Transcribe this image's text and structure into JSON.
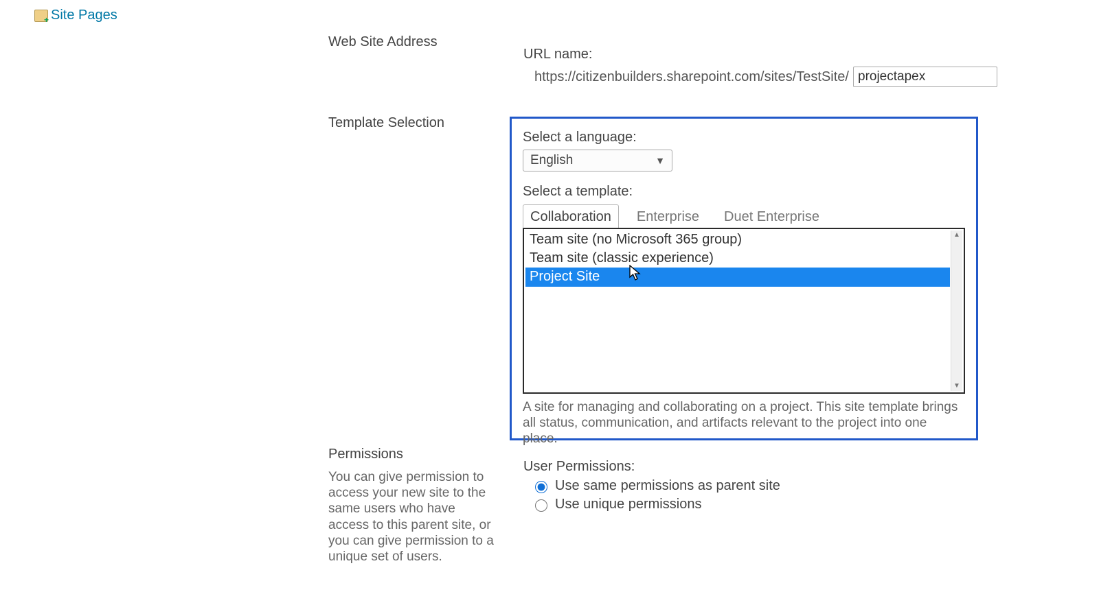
{
  "sidebar": {
    "site_pages": "Site Pages"
  },
  "sections": {
    "web_site_address": "Web Site Address",
    "template_selection": "Template Selection",
    "permissions": "Permissions"
  },
  "permissions_description": "You can give permission to access your new site to the same users who have access to this parent site, or you can give permission to a unique set of users.",
  "url": {
    "label": "URL name:",
    "prefix": "https://citizenbuilders.sharepoint.com/sites/TestSite/",
    "value": "projectapex"
  },
  "language": {
    "label": "Select a language:",
    "selected": "English"
  },
  "template": {
    "label": "Select a template:",
    "tabs": {
      "collaboration": "Collaboration",
      "enterprise": "Enterprise",
      "duet": "Duet Enterprise"
    },
    "options": {
      "team_no_group": "Team site (no Microsoft 365 group)",
      "team_classic": "Team site (classic experience)",
      "project_site": "Project Site"
    },
    "description": "A site for managing and collaborating on a project. This site template brings all status, communication, and artifacts relevant to the project into one place."
  },
  "permissions_group": {
    "label": "User Permissions:",
    "same": "Use same permissions as parent site",
    "unique": "Use unique permissions"
  }
}
